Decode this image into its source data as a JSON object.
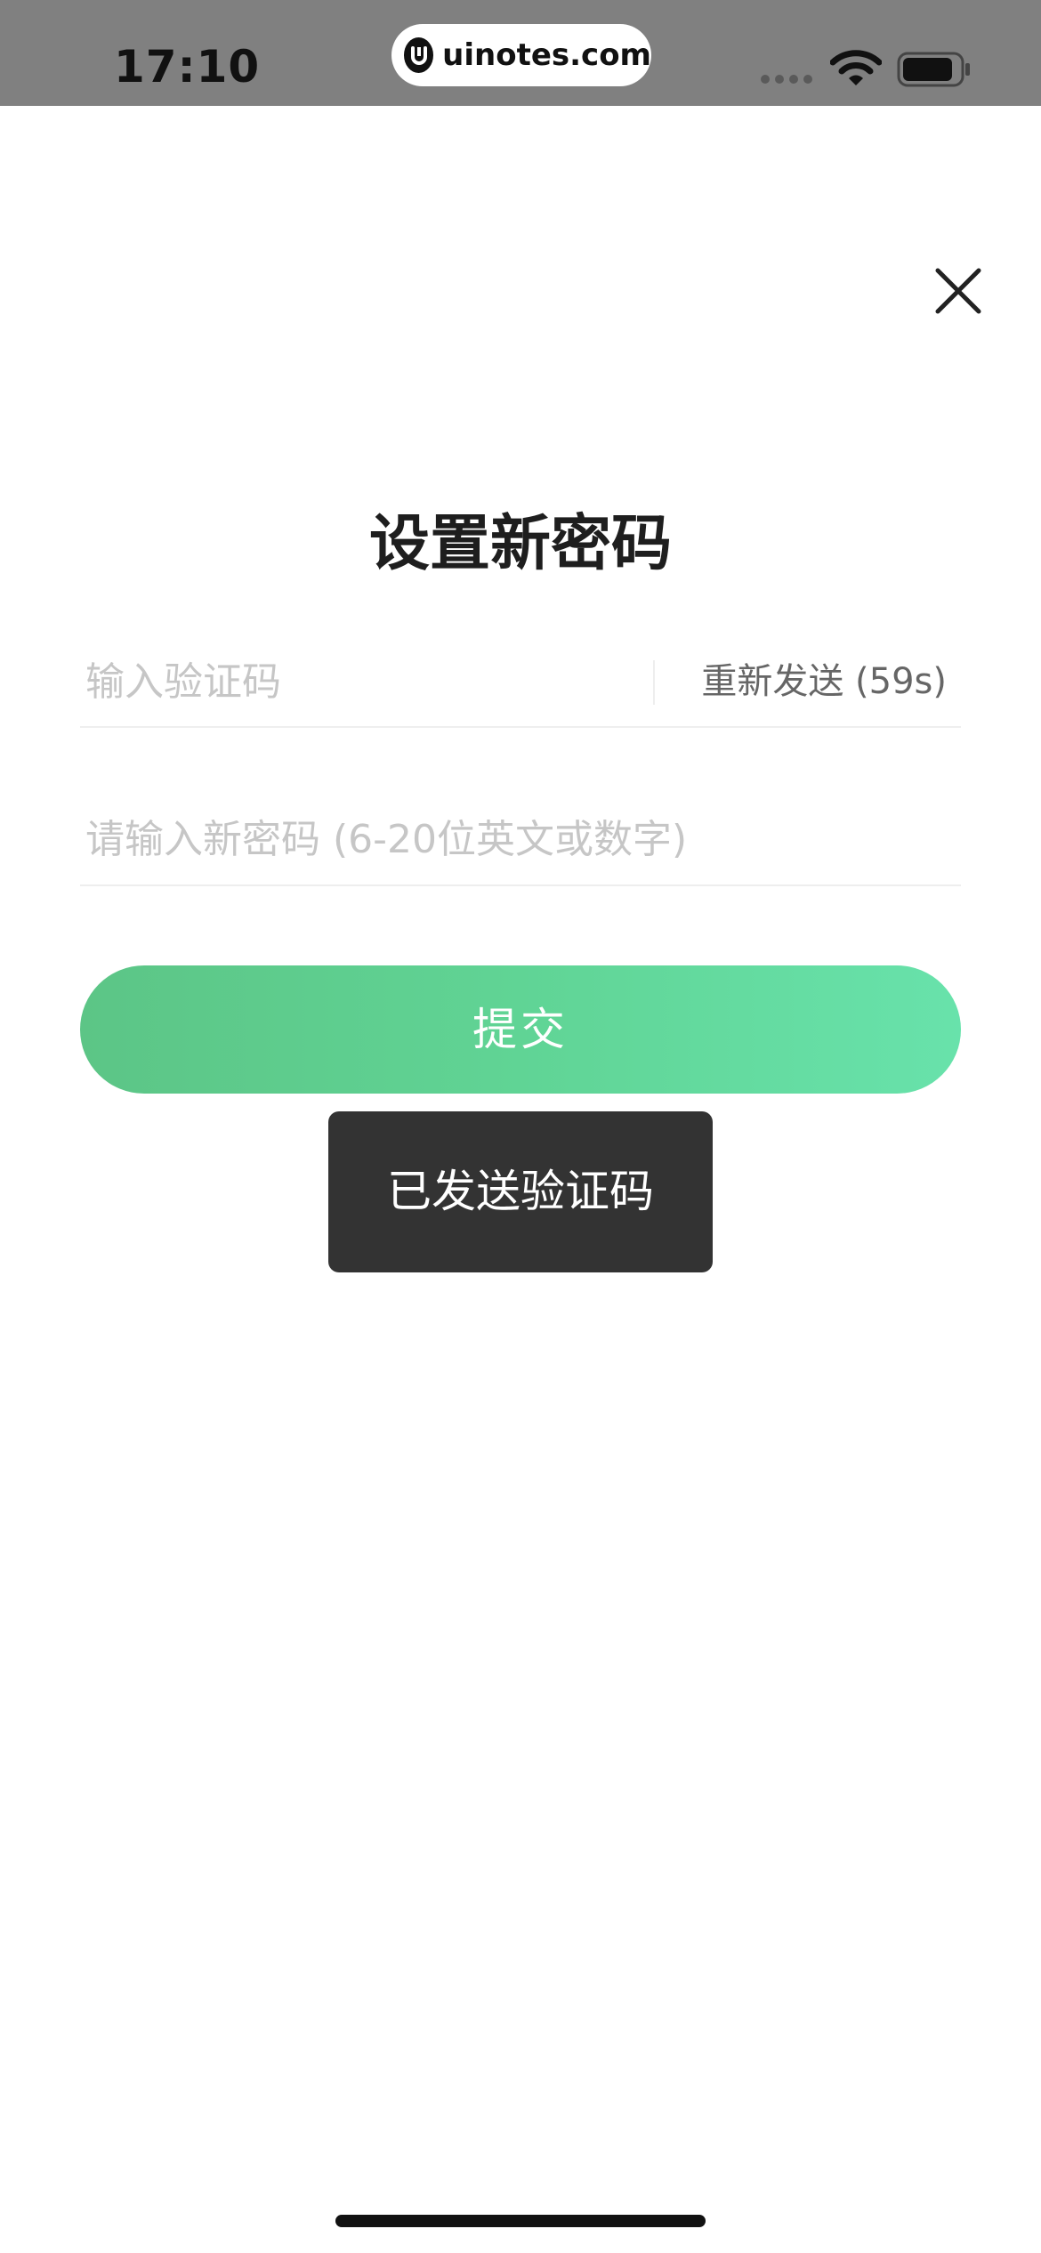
{
  "status_bar": {
    "time": "17:10",
    "url": "uinotes.com"
  },
  "screen": {
    "title": "设置新密码",
    "code_field": {
      "placeholder": "输入验证码",
      "value": "",
      "resend_label": "重新发送 (59s)"
    },
    "password_field": {
      "placeholder": "请输入新密码 (6-20位英文或数字)",
      "value": ""
    },
    "submit_label": "提交"
  },
  "toast": {
    "message": "已发送验证码"
  },
  "colors": {
    "status_bar_bg": "#808080",
    "button_gradient_start": "#5cc586",
    "button_gradient_end": "#68e2ab",
    "toast_bg": "#333333"
  },
  "icons": {
    "close": "close-icon",
    "wifi": "wifi-icon",
    "battery": "battery-icon",
    "url_logo": "uinotes-logo-icon"
  }
}
